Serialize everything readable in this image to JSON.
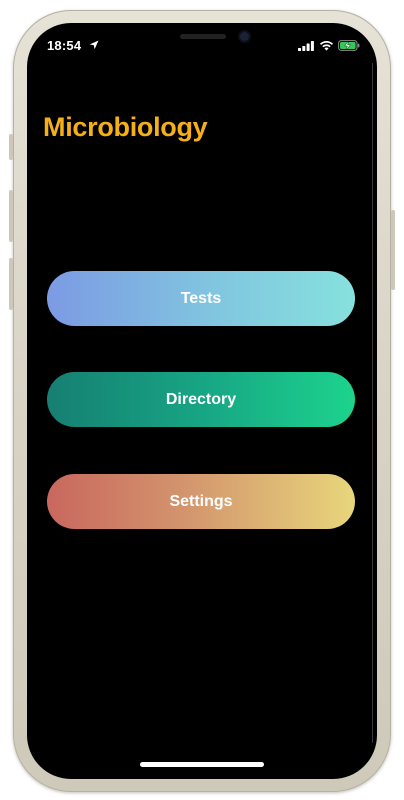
{
  "status_bar": {
    "time": "18:54",
    "icons": {
      "location": "location-arrow-icon",
      "signal": "cellular-signal-icon",
      "wifi": "wifi-icon",
      "battery": "battery-charging-icon"
    }
  },
  "app": {
    "title": "Microbiology",
    "title_color": "#f5b017"
  },
  "menu": {
    "tests_label": "Tests",
    "directory_label": "Directory",
    "settings_label": "Settings"
  },
  "colors": {
    "tests_gradient": [
      "#7c9ae4",
      "#86e1dd"
    ],
    "directory_gradient": [
      "#167f72",
      "#1dd38d"
    ],
    "settings_gradient": [
      "#c9675e",
      "#e8d67c"
    ],
    "background": "#000000"
  }
}
